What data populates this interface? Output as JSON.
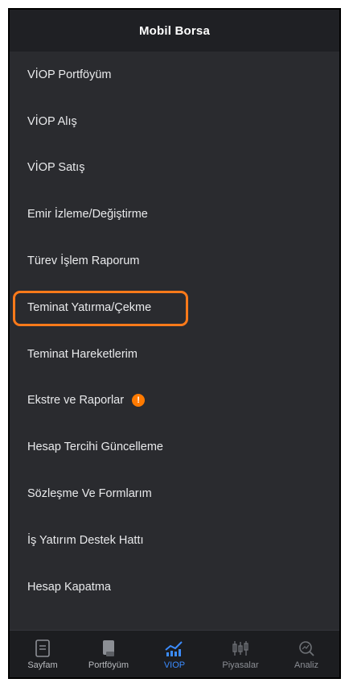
{
  "app": {
    "title": "Mobil Borsa"
  },
  "menu": {
    "items": [
      {
        "label": "VİOP Portföyüm"
      },
      {
        "label": "VİOP Alış"
      },
      {
        "label": "VİOP Satış"
      },
      {
        "label": "Emir İzleme/Değiştirme"
      },
      {
        "label": "Türev İşlem Raporum"
      },
      {
        "label": "Teminat Yatırma/Çekme",
        "highlighted": true
      },
      {
        "label": "Teminat Hareketlerim"
      },
      {
        "label": "Ekstre ve Raporlar",
        "badge": "!"
      },
      {
        "label": "Hesap Tercihi Güncelleme"
      },
      {
        "label": "Sözleşme Ve Formlarım"
      },
      {
        "label": "İş Yatırım Destek Hattı"
      },
      {
        "label": "Hesap Kapatma"
      }
    ]
  },
  "tabbar": {
    "tabs": [
      {
        "label": "Sayfam",
        "icon": "document-icon"
      },
      {
        "label": "Portföyüm",
        "icon": "portfolio-icon"
      },
      {
        "label": "VIOP",
        "icon": "chart-icon",
        "active": true
      },
      {
        "label": "Piyasalar",
        "icon": "candlestick-icon"
      },
      {
        "label": "Analiz",
        "icon": "analysis-icon"
      }
    ]
  },
  "colors": {
    "background": "#2a2b2f",
    "highlight": "#ff7a1a",
    "active_tab": "#3b8cff",
    "badge": "#ff7a00"
  }
}
